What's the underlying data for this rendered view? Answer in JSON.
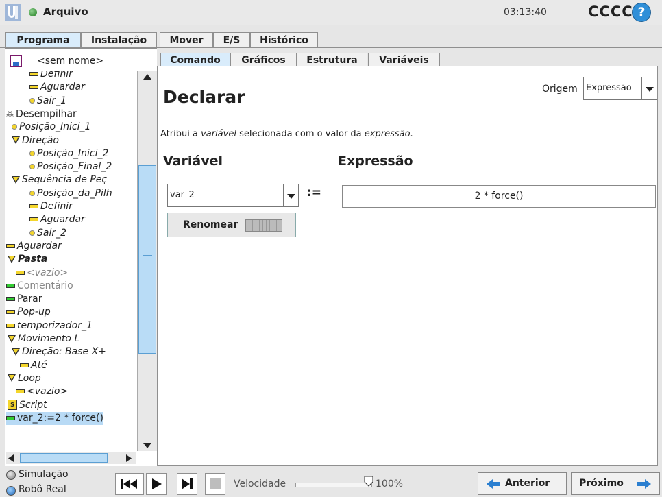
{
  "header": {
    "app_title": "Arquivo",
    "clock": "03:13:40",
    "user_name": "CCCC",
    "help_glyph": "?"
  },
  "main_tabs": [
    {
      "label": "Programa",
      "active": true
    },
    {
      "label": "Instalação",
      "active": false
    },
    {
      "label": "Mover",
      "active": false
    },
    {
      "label": "E/S",
      "active": false
    },
    {
      "label": "Histórico",
      "active": false
    }
  ],
  "left_panel": {
    "program_name": "<sem nome>",
    "tree": [
      {
        "label": "Definir",
        "icon": "bar-icon"
      },
      {
        "label": "Aguardar",
        "icon": "bar-icon"
      },
      {
        "label": "Sair_1",
        "icon": "waypoint-icon"
      },
      {
        "label": "Desempilhar",
        "icon": "stack-icon"
      },
      {
        "label": "Posição_Inici_1",
        "icon": "waypoint-icon"
      },
      {
        "label": "Direção",
        "icon": "folder-triangle-icon"
      },
      {
        "label": "Posição_Inici_2",
        "icon": "waypoint-icon"
      },
      {
        "label": "Posição_Final_2",
        "icon": "waypoint-icon"
      },
      {
        "label": "Sequência de Peç",
        "icon": "folder-triangle-icon"
      },
      {
        "label": "Posição_da_Pilh",
        "icon": "waypoint-icon"
      },
      {
        "label": "Definir",
        "icon": "bar-icon"
      },
      {
        "label": "Aguardar",
        "icon": "bar-icon"
      },
      {
        "label": "Sair_2",
        "icon": "waypoint-icon"
      },
      {
        "label": "Aguardar",
        "icon": "bar-icon"
      },
      {
        "label": "Pasta",
        "icon": "folder-triangle-icon"
      },
      {
        "label": "<vazio>",
        "icon": "bar-icon"
      },
      {
        "label": "Comentário",
        "icon": "bar-green-icon"
      },
      {
        "label": "Parar",
        "icon": "bar-green-icon"
      },
      {
        "label": "Pop-up",
        "icon": "bar-icon"
      },
      {
        "label": "temporizador_1",
        "icon": "bar-icon"
      },
      {
        "label": "Movimento L",
        "icon": "folder-triangle-icon"
      },
      {
        "label": "Direção: Base X+",
        "icon": "folder-triangle-icon"
      },
      {
        "label": "Até",
        "icon": "bar-icon"
      },
      {
        "label": "Loop",
        "icon": "folder-triangle-icon"
      },
      {
        "label": "<vazio>",
        "icon": "bar-icon"
      },
      {
        "label": "Script",
        "icon": "script-icon"
      },
      {
        "label": "var_2:=2 * force()",
        "icon": "bar-green-icon",
        "selected": true
      }
    ],
    "toolbar": {
      "search_icon": "search-icon",
      "undo_icon": "undo-icon",
      "redo_icon": "redo-icon",
      "move_glyph": "◀----▶"
    }
  },
  "sub_tabs": [
    {
      "label": "Comando",
      "active": true
    },
    {
      "label": "Gráficos",
      "active": false
    },
    {
      "label": "Estrutura",
      "active": false
    },
    {
      "label": "Variáveis",
      "active": false
    }
  ],
  "command": {
    "title": "Declarar",
    "origin_label": "Origem",
    "origin_value": "Expressão",
    "desc_prefix": "Atribui a ",
    "desc_em1": "variável",
    "desc_middle": " selecionada com o valor da ",
    "desc_em2": "expressão",
    "desc_suffix": ".",
    "variable_heading": "Variável",
    "expression_heading": "Expressão",
    "variable_value": "var_2",
    "assign_operator": ":=",
    "expression_value": "2 * force()",
    "rename_label": "Renomear"
  },
  "footer": {
    "simulation_label": "Simulação",
    "real_robot_label": "Robô Real",
    "speed_label": "Velocidade",
    "speed_value": "100%",
    "speed_fraction": 1.0,
    "prev_label": "Anterior",
    "next_label": "Próximo"
  },
  "colors": {
    "active_tab": "#d9ecfb",
    "selection": "#b8daf5",
    "help_blue": "#2f8fd8",
    "status_green": "#1c7a1c",
    "node_yellow": "#f4d62c",
    "node_green": "#33cc33"
  }
}
